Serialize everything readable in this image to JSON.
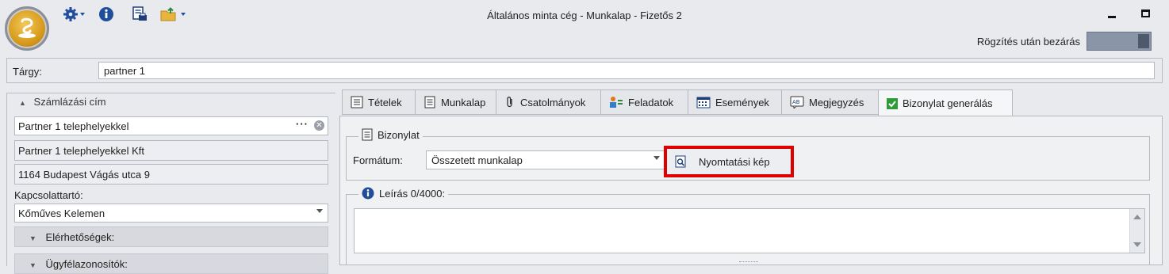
{
  "window": {
    "title": "Általános minta cég - Munkalap - Fizetős 2",
    "close_after_save_label": "Rögzítés után bezárás"
  },
  "toolbar": {
    "icons": [
      "gear-icon",
      "info-icon",
      "print-icon",
      "export-icon"
    ]
  },
  "subject": {
    "label": "Tárgy:",
    "value": "partner 1"
  },
  "billing": {
    "caption": "Számlázási cím",
    "partner_value": "Partner 1 telephelyekkel",
    "partner_name": "Partner 1 telephelyekkel Kft",
    "address": "1164 Budapest Vágás utca 9",
    "contact_label": "Kapcsolattartó:",
    "contact_value": "Kőműves Kelemen",
    "section1": "Elérhetőségek:",
    "section2": "Ügyfélazonosítók:"
  },
  "tabs": [
    {
      "label": "Tételek",
      "icon": "list-icon"
    },
    {
      "label": "Munkalap",
      "icon": "document-icon"
    },
    {
      "label": "Csatolmányok",
      "icon": "paperclip-icon"
    },
    {
      "label": "Feladatok",
      "icon": "tasks-icon"
    },
    {
      "label": "Események",
      "icon": "calendar-icon"
    },
    {
      "label": "Megjegyzés",
      "icon": "note-icon"
    },
    {
      "label": "Bizonylat generálás",
      "icon": "checkbox-icon"
    }
  ],
  "document": {
    "group_label": "Bizonylat",
    "format_label": "Formátum:",
    "format_value": "Összetett munkalap",
    "preview_button": "Nyomtatási kép",
    "description_label": "Leírás 0/4000:"
  },
  "colors": {
    "highlight": "#e00000",
    "accent_blue": "#1f4e9c",
    "toggle": "#8a95a7"
  }
}
